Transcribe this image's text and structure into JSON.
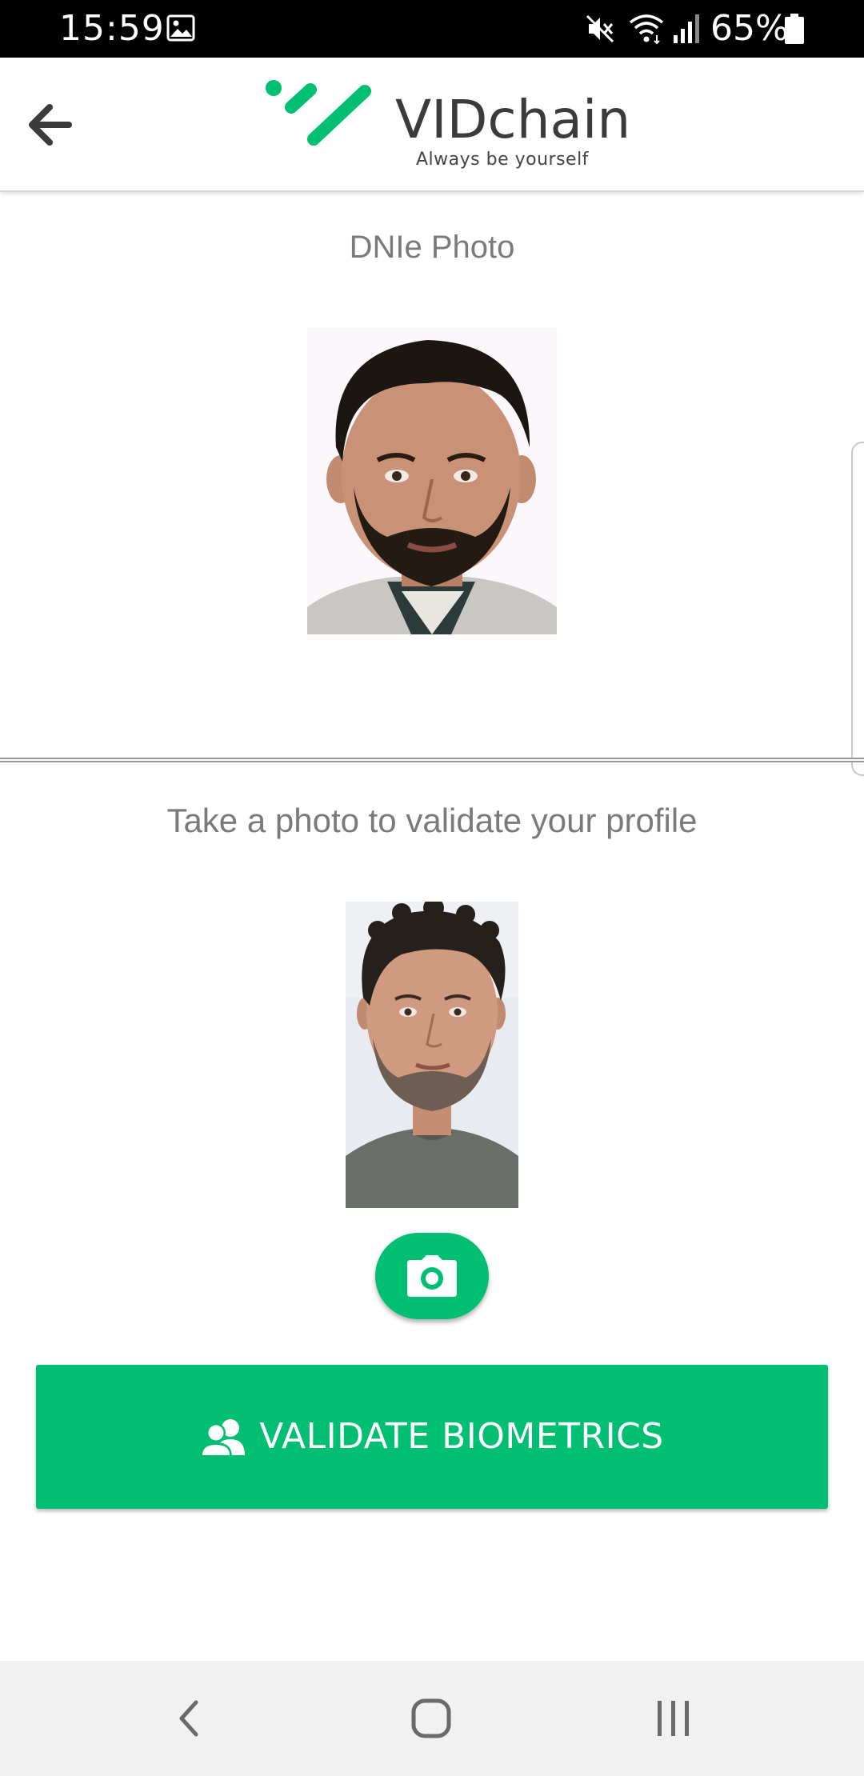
{
  "status_bar": {
    "time": "15:59",
    "battery": "65%",
    "icons": [
      "gallery-icon",
      "mute-icon",
      "wifi-icon",
      "signal-icon",
      "battery-icon"
    ]
  },
  "header": {
    "back_icon": "arrow-left-icon",
    "brand_name": "VIDchain",
    "tagline": "Always be yourself",
    "brand_color": "#00bf72"
  },
  "dnie": {
    "title": "DNIe Photo"
  },
  "selfie": {
    "title": "Take a photo to validate your profile",
    "camera_icon": "camera-icon"
  },
  "validate_button": {
    "label": "VALIDATE BIOMETRICS",
    "icon": "users-icon",
    "color": "#00bf72"
  },
  "nav_bar": {
    "items": [
      "back-icon",
      "home-icon",
      "recents-icon"
    ]
  }
}
